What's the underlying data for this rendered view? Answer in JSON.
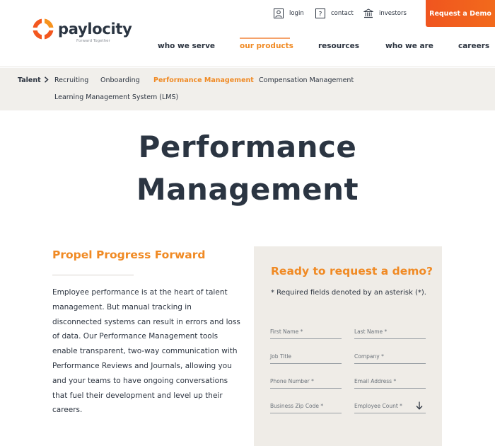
{
  "brand": {
    "name": "paylocity",
    "tagline": "Forward Together",
    "colors": {
      "orange": "#f08a24",
      "demo": "#f3571f",
      "navy": "#2b3542",
      "band": "#f1efeb",
      "card": "#efece7"
    }
  },
  "utility_nav": {
    "login": "login",
    "contact": "contact",
    "investors": "investors"
  },
  "cta": {
    "label": "Request a Demo"
  },
  "main_nav": [
    {
      "label": "who we serve",
      "active": false
    },
    {
      "label": "our products",
      "active": true
    },
    {
      "label": "resources",
      "active": false
    },
    {
      "label": "who we are",
      "active": false
    },
    {
      "label": "careers",
      "active": false
    }
  ],
  "breadcrumb": {
    "root": "Talent",
    "items": [
      {
        "label": "Recruiting",
        "active": false
      },
      {
        "label": "Onboarding",
        "active": false
      },
      {
        "label": "Performance Management",
        "active": true
      },
      {
        "label": "Compensation Management",
        "active": false
      },
      {
        "label": "Learning Management System (LMS)",
        "active": false
      }
    ]
  },
  "hero": {
    "title_line1": "Performance",
    "title_line2": "Management"
  },
  "intro": {
    "heading": "Propel Progress Forward",
    "body": "Employee performance is at the heart of talent management. But manual tracking in disconnected systems can result in errors and loss of data. Our Performance Management tools enable transparent, two-way communication with Performance Reviews and Journals, allowing you and your teams to have ongoing conversations that fuel their development and level up their careers."
  },
  "form": {
    "title": "Ready to request a demo?",
    "note": "* Required fields denoted by an asterisk (*).",
    "fields": {
      "first_name": "First Name *",
      "last_name": "Last Name *",
      "job_title": "Job Title",
      "company": "Company *",
      "phone": "Phone Number *",
      "email": "Email Address *",
      "zip": "Business Zip Code *",
      "employee_count": "Employee Count *"
    }
  }
}
